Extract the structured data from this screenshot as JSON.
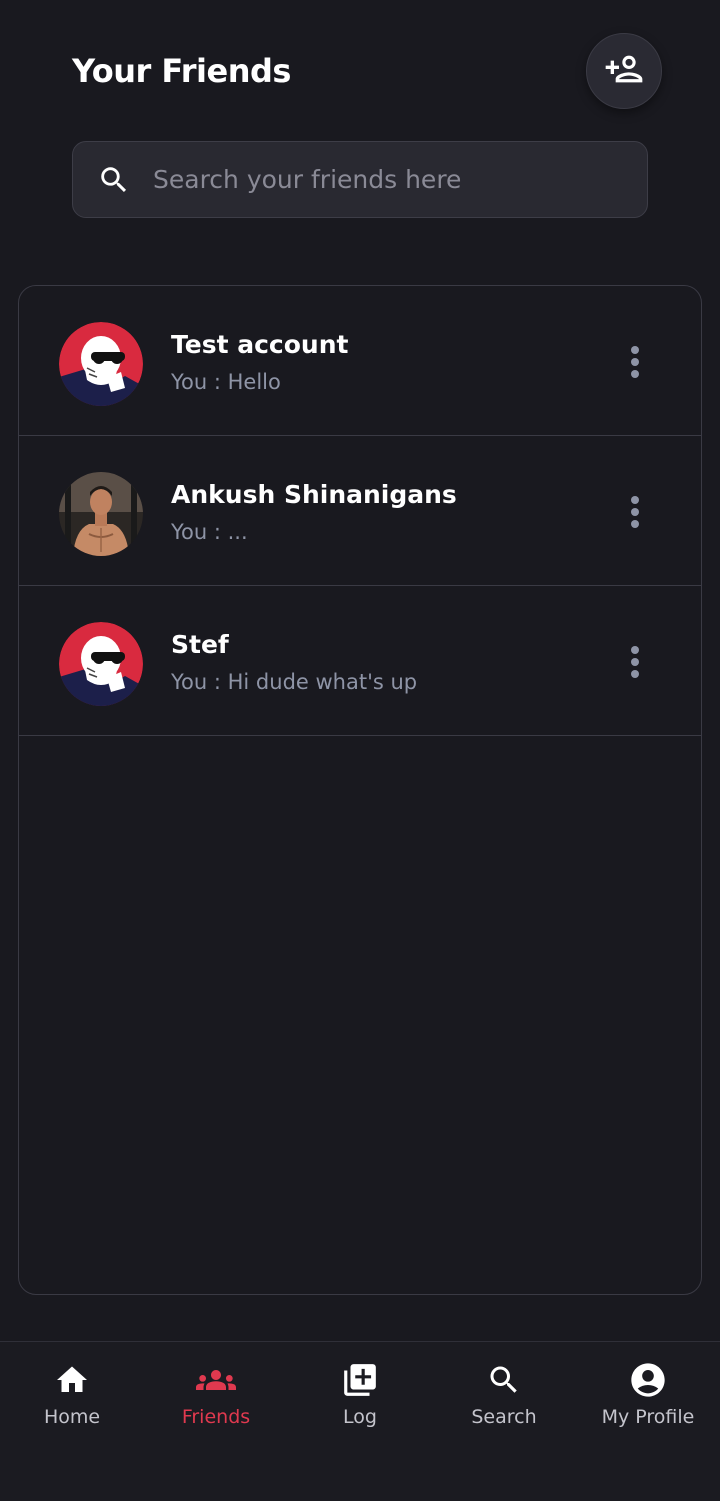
{
  "header": {
    "title": "Your Friends",
    "add_friend_icon": "person-add-icon"
  },
  "search": {
    "icon": "search-icon",
    "placeholder": "Search your friends here",
    "value": ""
  },
  "friends": [
    {
      "name": "Test account",
      "last_message": "You : Hello",
      "avatar": "cartoon-sunglasses-avatar"
    },
    {
      "name": "Ankush Shinanigans",
      "last_message": "You : ...",
      "avatar": "photo-avatar"
    },
    {
      "name": "Stef",
      "last_message": "You : Hi dude what's up",
      "avatar": "cartoon-sunglasses-avatar"
    }
  ],
  "nav": {
    "items": [
      {
        "label": "Home",
        "icon": "home-icon",
        "active": false
      },
      {
        "label": "Friends",
        "icon": "group-icon",
        "active": true
      },
      {
        "label": "Log",
        "icon": "add-box-icon",
        "active": false
      },
      {
        "label": "Search",
        "icon": "search-icon",
        "active": false
      },
      {
        "label": "My Profile",
        "icon": "account-circle-icon",
        "active": false
      }
    ]
  },
  "colors": {
    "background": "#19191f",
    "accent": "#e0394f",
    "text_primary": "#ffffff",
    "text_secondary": "#8e94a6"
  }
}
